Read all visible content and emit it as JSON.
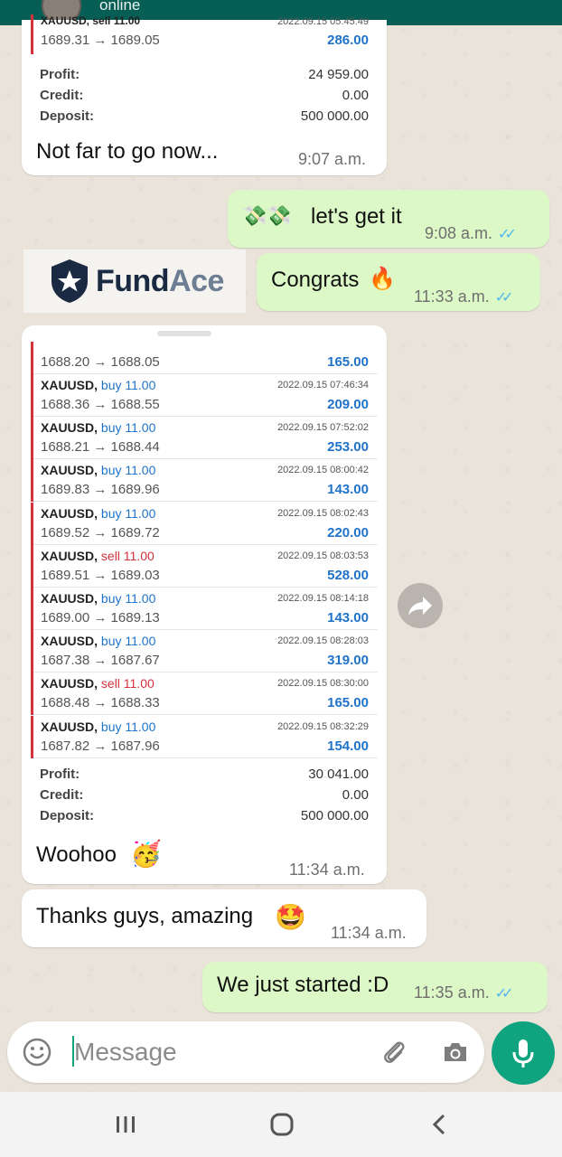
{
  "header": {
    "status": "online"
  },
  "messages": {
    "first_report": {
      "partial_top_symbol": "XAUUSD, sell 11.00",
      "partial_top_datetime": "2022.09.15 05:45:49",
      "partial_top_prices": "1689.31 → 1689.05",
      "partial_top_profit": "286.00",
      "profit_label": "Profit:",
      "profit_value": "24 959.00",
      "credit_label": "Credit:",
      "credit_value": "0.00",
      "deposit_label": "Deposit:",
      "deposit_value": "500 000.00",
      "caption": "Not far to go now...",
      "time": "9:07 a.m."
    },
    "lets_get_it": {
      "text": "let's get it",
      "emoji": "💸💸",
      "time": "9:08 a.m."
    },
    "logo": {
      "brand_part1": "Fund",
      "brand_part2": "Ace"
    },
    "congrats": {
      "text": "Congrats",
      "emoji": "🔥",
      "time": "11:33 a.m."
    },
    "second_report": {
      "first_prices": "1688.20 → 1688.05",
      "first_profit": "165.00",
      "trades": [
        {
          "symbol": "XAUUSD,",
          "side": "buy 11.00",
          "type": "buy",
          "datetime": "2022.09.15 07:46:34",
          "prices": "1688.36 → 1688.55",
          "profit": "209.00"
        },
        {
          "symbol": "XAUUSD,",
          "side": "buy 11.00",
          "type": "buy",
          "datetime": "2022.09.15 07:52:02",
          "prices": "1688.21 → 1688.44",
          "profit": "253.00"
        },
        {
          "symbol": "XAUUSD,",
          "side": "buy 11.00",
          "type": "buy",
          "datetime": "2022.09.15 08:00:42",
          "prices": "1689.83 → 1689.96",
          "profit": "143.00"
        },
        {
          "symbol": "XAUUSD,",
          "side": "buy 11.00",
          "type": "buy",
          "datetime": "2022.09.15 08:02:43",
          "prices": "1689.52 → 1689.72",
          "profit": "220.00"
        },
        {
          "symbol": "XAUUSD,",
          "side": "sell 11.00",
          "type": "sell",
          "datetime": "2022.09.15 08:03:53",
          "prices": "1689.51 → 1689.03",
          "profit": "528.00"
        },
        {
          "symbol": "XAUUSD,",
          "side": "buy 11.00",
          "type": "buy",
          "datetime": "2022.09.15 08:14:18",
          "prices": "1689.00 → 1689.13",
          "profit": "143.00"
        },
        {
          "symbol": "XAUUSD,",
          "side": "buy 11.00",
          "type": "buy",
          "datetime": "2022.09.15 08:28:03",
          "prices": "1687.38 → 1687.67",
          "profit": "319.00"
        },
        {
          "symbol": "XAUUSD,",
          "side": "sell 11.00",
          "type": "sell",
          "datetime": "2022.09.15 08:30:00",
          "prices": "1688.48 → 1688.33",
          "profit": "165.00"
        },
        {
          "symbol": "XAUUSD,",
          "side": "buy 11.00",
          "type": "buy",
          "datetime": "2022.09.15 08:32:29",
          "prices": "1687.82 → 1687.96",
          "profit": "154.00"
        }
      ],
      "profit_label": "Profit:",
      "profit_value": "30 041.00",
      "credit_label": "Credit:",
      "credit_value": "0.00",
      "deposit_label": "Deposit:",
      "deposit_value": "500 000.00",
      "caption": "Woohoo",
      "emoji": "🥳",
      "time": "11:34 a.m."
    },
    "thanks": {
      "text": "Thanks guys, amazing",
      "emoji": "🤩",
      "time": "11:34 a.m."
    },
    "started": {
      "text": "We just started :D",
      "time": "11:35 a.m."
    }
  },
  "input": {
    "placeholder": "Message"
  },
  "icons": [
    "emoji-icon",
    "attach-icon",
    "camera-icon",
    "mic-icon",
    "forward-icon",
    "recent-apps-icon",
    "home-icon",
    "back-icon",
    "shield-star-icon"
  ],
  "colors": {
    "header": "#075e54",
    "outgoing": "#dcf8c6",
    "incoming": "#ffffff",
    "accent": "#0fa37f",
    "read_ticks": "#4fb6ec",
    "sell": "#d3313b",
    "buy": "#1f73c9"
  }
}
